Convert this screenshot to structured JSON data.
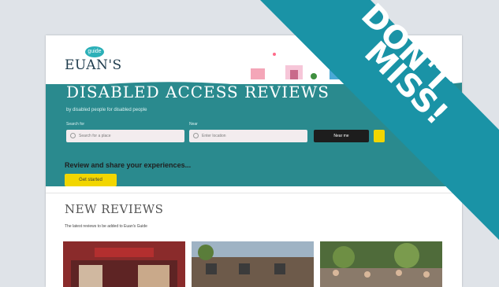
{
  "brand": {
    "name": "EUAN'S",
    "bubble": "guide"
  },
  "hero": {
    "title": "DISABLED ACCESS REVIEWS",
    "subtitle": "by disabled people for disabled people",
    "search_label": "Search for",
    "search_placeholder": "Search for a place",
    "near_label": "Near",
    "near_placeholder": "Enter location",
    "search_button": "Near me"
  },
  "cta": {
    "heading": "Review and share your experiences...",
    "button": "Get started"
  },
  "new_reviews": {
    "title": "NEW REVIEWS",
    "subtitle": "The latest reviews to be added to Euan's Guide"
  },
  "banner": {
    "line1": "DON'T",
    "line2": "MISS!",
    "color": "#1a93a6"
  },
  "colors": {
    "hero": "#2a8a8e",
    "accent": "#f2d600"
  }
}
